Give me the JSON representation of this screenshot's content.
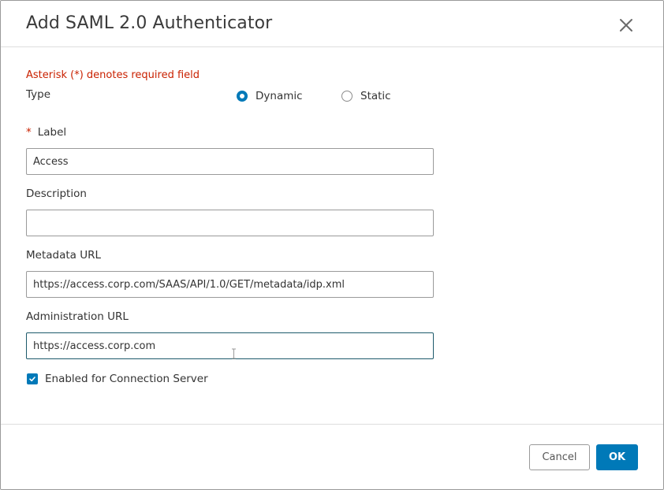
{
  "dialog": {
    "title": "Add SAML 2.0 Authenticator",
    "close_icon": "close-icon"
  },
  "form": {
    "required_note": "Asterisk (*) denotes required field",
    "type": {
      "label": "Type",
      "options": [
        {
          "label": "Dynamic",
          "selected": true
        },
        {
          "label": "Static",
          "selected": false
        }
      ]
    },
    "label_field": {
      "required_marker": "*",
      "label": "Label",
      "value": "Access"
    },
    "description_field": {
      "label": "Description",
      "value": ""
    },
    "metadata_url_field": {
      "label": "Metadata URL",
      "value": "https://access.corp.com/SAAS/API/1.0/GET/metadata/idp.xml"
    },
    "administration_url_field": {
      "label": "Administration URL",
      "value": "https://access.corp.com"
    },
    "enabled_checkbox": {
      "label": "Enabled for Connection Server",
      "checked": true
    }
  },
  "footer": {
    "cancel_label": "Cancel",
    "ok_label": "OK"
  },
  "colors": {
    "accent": "#0079b8",
    "required": "#c92100",
    "border": "#9a9a9a"
  }
}
